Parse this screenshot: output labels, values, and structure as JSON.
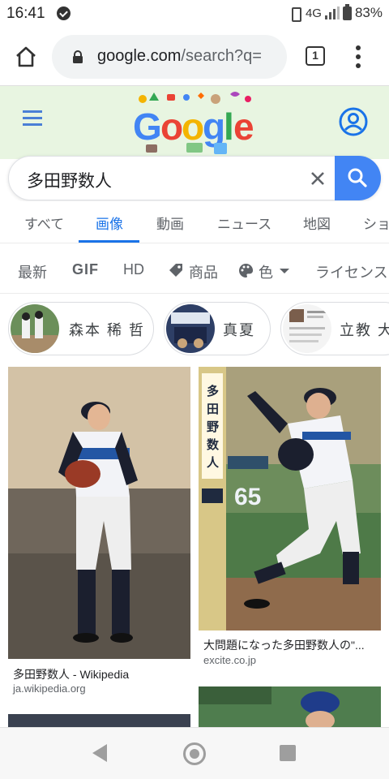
{
  "status_bar": {
    "time": "16:41",
    "network": "4G",
    "battery": "83%"
  },
  "browser": {
    "url_host": "google.com",
    "url_path": "/search?q=",
    "tab_count": "1"
  },
  "search": {
    "query": "多田野数人"
  },
  "tabs": [
    {
      "label": "すべて"
    },
    {
      "label": "画像"
    },
    {
      "label": "動画"
    },
    {
      "label": "ニュース"
    },
    {
      "label": "地図"
    },
    {
      "label": "ショ"
    }
  ],
  "active_tab": 1,
  "filters": [
    {
      "label": "最新"
    },
    {
      "label": "GIF"
    },
    {
      "label": "HD"
    },
    {
      "label": "商品"
    },
    {
      "label": "色"
    },
    {
      "label": "ライセンス"
    }
  ],
  "related": [
    {
      "label": "森本 稀 哲"
    },
    {
      "label": "真夏"
    },
    {
      "label": "立教 大"
    }
  ],
  "results": [
    {
      "title": "多田野数人 - Wikipedia",
      "source": "ja.wikipedia.org"
    },
    {
      "title": "大問題になった多田野数人の\"...",
      "source": "excite.co.jp"
    }
  ],
  "card": {
    "name_vertical": "多田野数人",
    "number": "65"
  },
  "colors": {
    "google_blue": "#4285f4",
    "active_tab": "#1a73e8",
    "header_bg": "#e8f5e1"
  }
}
